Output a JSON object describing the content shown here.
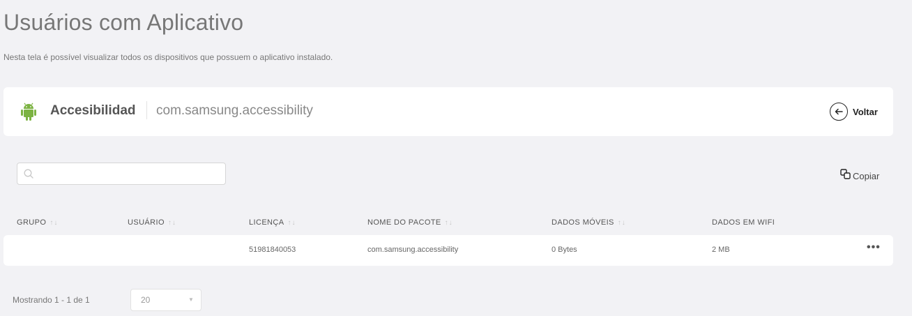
{
  "page": {
    "title": "Usuários com Aplicativo",
    "subtitle": "Nesta tela é possível visualizar todos os dispositivos que possuem o aplicativo instalado."
  },
  "app": {
    "name": "Accesibilidad",
    "package": "com.samsung.accessibility",
    "icon": "android-icon",
    "icon_color": "#7cb342",
    "back_label": "Voltar"
  },
  "search": {
    "value": "",
    "placeholder": ""
  },
  "toolbar": {
    "copy_label": "Copiar"
  },
  "table": {
    "columns": [
      {
        "label": "GRUPO",
        "sortable": true
      },
      {
        "label": "USUÁRIO",
        "sortable": true
      },
      {
        "label": "LICENÇA",
        "sortable": true
      },
      {
        "label": "NOME DO PACOTE",
        "sortable": true
      },
      {
        "label": "DADOS MÓVEIS",
        "sortable": true
      },
      {
        "label": "DADOS EM WIFI",
        "sortable": false
      }
    ],
    "rows": [
      {
        "grupo": "",
        "usuario": "",
        "licenca": "51981840053",
        "pacote": "com.samsung.accessibility",
        "dados_moveis": "0 Bytes",
        "dados_wifi": "2 MB",
        "menu": "•••"
      }
    ],
    "sort_glyph": "↑↓"
  },
  "pagination": {
    "info": "Mostrando 1 - 1 de 1",
    "page_size": "20",
    "caret": "▼"
  }
}
